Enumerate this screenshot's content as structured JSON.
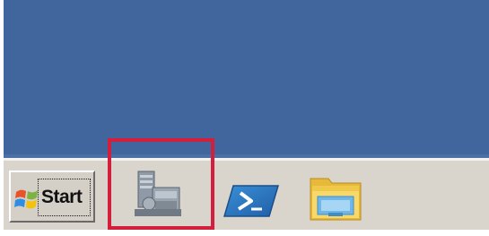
{
  "taskbar": {
    "start_label": "Start",
    "items": [
      {
        "icon": "server-manager-icon",
        "highlighted": true
      },
      {
        "icon": "powershell-icon",
        "highlighted": false
      },
      {
        "icon": "file-explorer-icon",
        "highlighted": false
      }
    ]
  },
  "colors": {
    "desktop": "#41669d",
    "taskbar": "#d9d5cd",
    "highlight": "#d31f3b"
  }
}
